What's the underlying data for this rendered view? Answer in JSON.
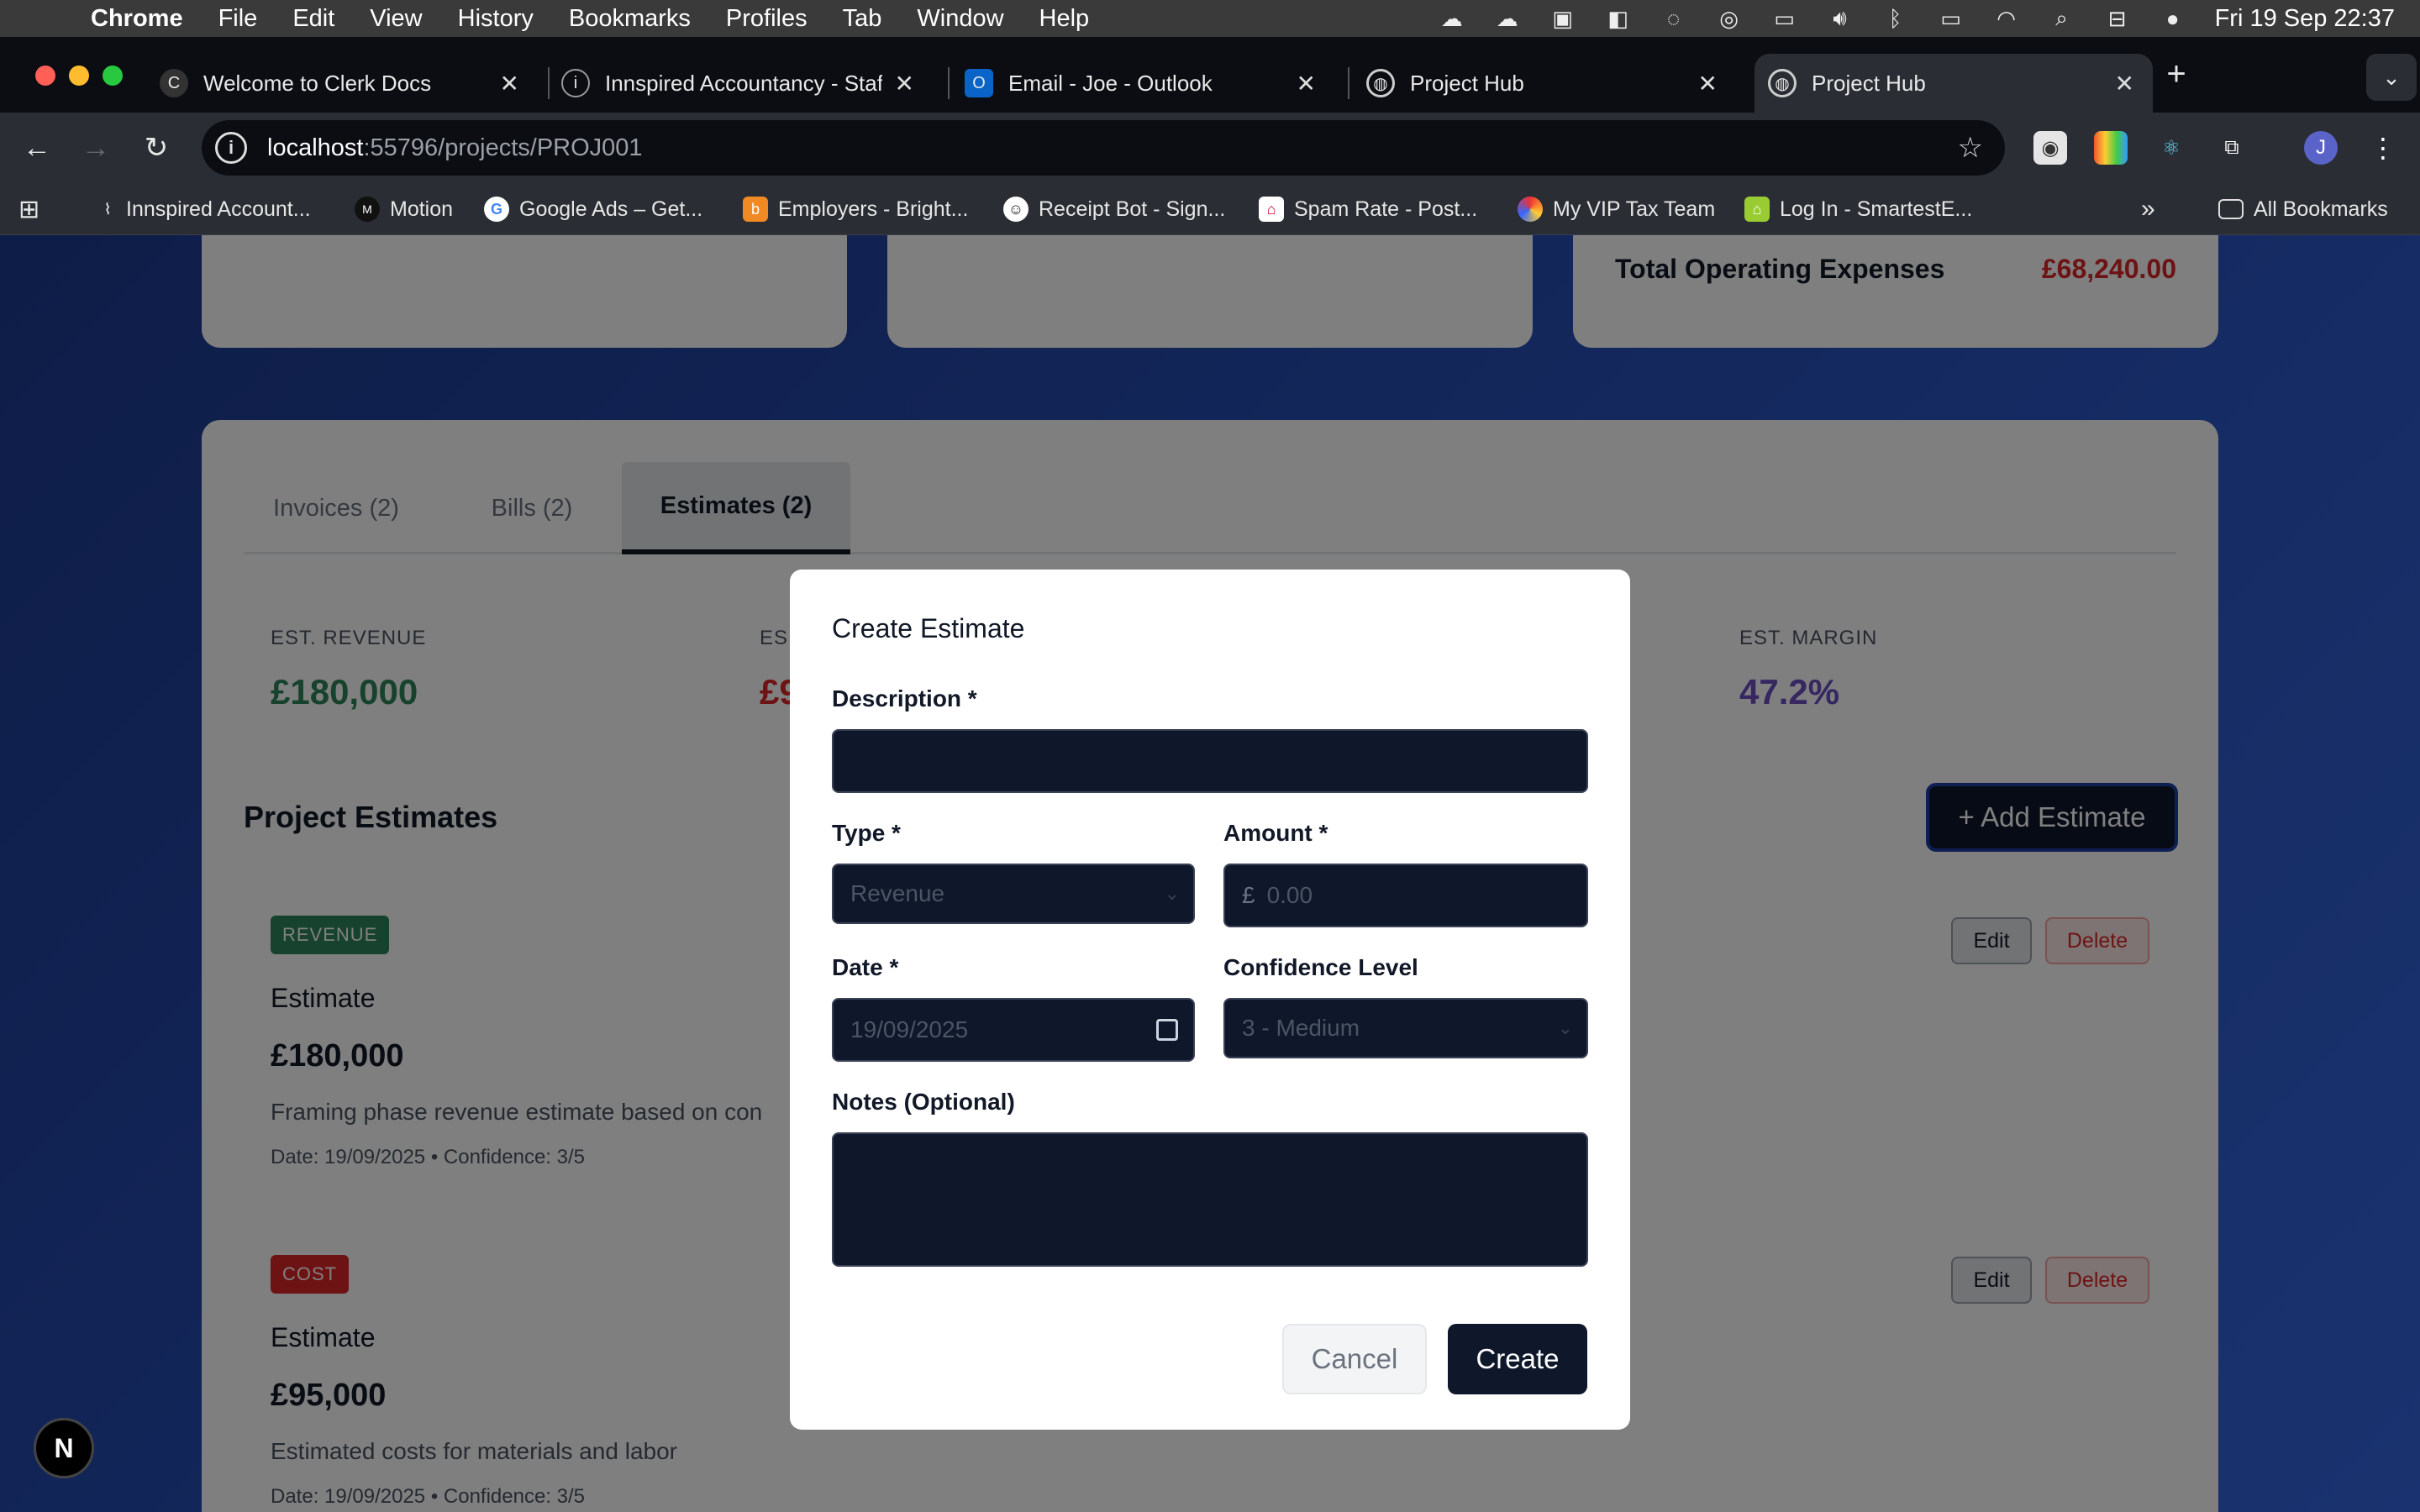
{
  "menubar": {
    "app": "Chrome",
    "items": [
      "File",
      "Edit",
      "View",
      "History",
      "Bookmarks",
      "Profiles",
      "Tab",
      "Window",
      "Help"
    ],
    "clock": "Fri 19 Sep  22:37"
  },
  "tabs": [
    {
      "title": "Welcome to Clerk Docs",
      "icon": "clerk-icon"
    },
    {
      "title": "Innspired Accountancy - Staff",
      "icon": "innspired-icon"
    },
    {
      "title": "Email - Joe - Outlook",
      "icon": "outlook-icon"
    },
    {
      "title": "Project Hub",
      "icon": "globe-icon"
    },
    {
      "title": "Project Hub",
      "icon": "globe-icon",
      "active": true
    }
  ],
  "address": {
    "host": "localhost",
    "path": ":55796/projects/PROJ001"
  },
  "bookmarks": [
    {
      "label": "Innspired Account..."
    },
    {
      "label": "Motion"
    },
    {
      "label": "Google Ads – Get..."
    },
    {
      "label": "Employers - Bright..."
    },
    {
      "label": "Receipt Bot - Sign..."
    },
    {
      "label": "Spam Rate - Post..."
    },
    {
      "label": "My VIP Tax Team"
    },
    {
      "label": "Log In - SmartestE..."
    }
  ],
  "all_bookmarks": "All Bookmarks",
  "summary": {
    "total_opex_label": "Total Operating Expenses",
    "total_opex_value": "£68,240.00"
  },
  "project_tabs": [
    "Invoices (2)",
    "Bills (2)",
    "Estimates (2)"
  ],
  "stats": {
    "revenue_label": "EST. REVENUE",
    "revenue_value": "£180,000",
    "cost_label": "ES",
    "cost_value": "£9",
    "margin_label": "EST. MARGIN",
    "margin_value": "47.2%"
  },
  "estimates_section": {
    "title": "Project Estimates",
    "add_button": "+ Add Estimate"
  },
  "estimates": [
    {
      "badge": "REVENUE",
      "title": "Estimate",
      "amount": "£180,000",
      "description": "Framing phase revenue estimate based on con",
      "meta": "Date: 19/09/2025 • Confidence: 3/5"
    },
    {
      "badge": "COST",
      "title": "Estimate",
      "amount": "£95,000",
      "description": "Estimated costs for materials and labor",
      "meta": "Date: 19/09/2025 • Confidence: 3/5"
    }
  ],
  "row_actions": {
    "edit": "Edit",
    "delete": "Delete"
  },
  "modal": {
    "title": "Create Estimate",
    "description_label": "Description *",
    "type_label": "Type *",
    "type_value": "Revenue",
    "amount_label": "Amount *",
    "amount_prefix": "£",
    "amount_placeholder": "0.00",
    "date_label": "Date *",
    "date_value": "19/09/2025",
    "confidence_label": "Confidence Level",
    "confidence_value": "3 - Medium",
    "notes_label": "Notes (Optional)",
    "cancel": "Cancel",
    "create": "Create"
  },
  "next_badge": "N"
}
